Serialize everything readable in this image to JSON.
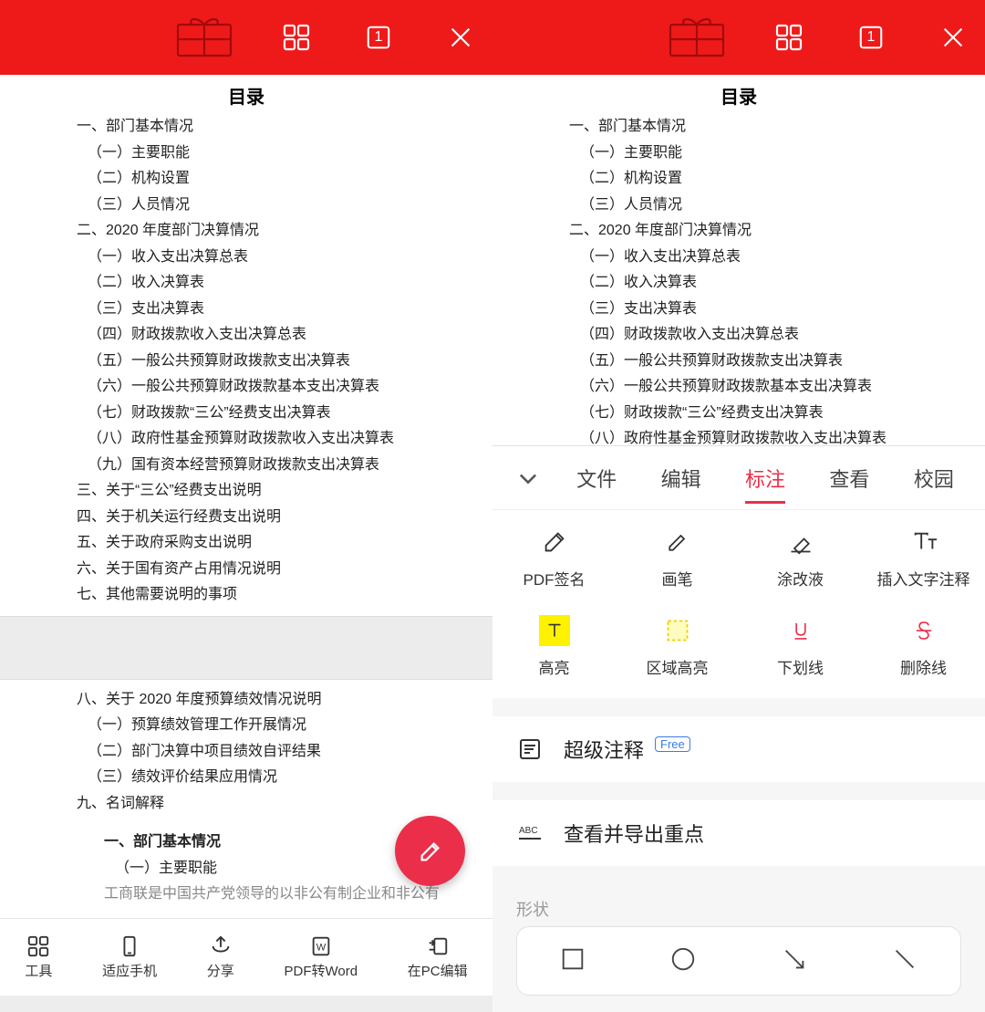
{
  "doc": {
    "title": "目录",
    "lines": [
      {
        "t": "一、部门基本情况",
        "i": 0
      },
      {
        "t": "（一）主要职能",
        "i": 1
      },
      {
        "t": "（二）机构设置",
        "i": 1
      },
      {
        "t": "（三）人员情况",
        "i": 1
      },
      {
        "t": "二、2020 年度部门决算情况",
        "i": 0
      },
      {
        "t": "（一）收入支出决算总表",
        "i": 1
      },
      {
        "t": "（二）收入决算表",
        "i": 1
      },
      {
        "t": "（三）支出决算表",
        "i": 1
      },
      {
        "t": "（四）财政拨款收入支出决算总表",
        "i": 1
      },
      {
        "t": "（五）一般公共预算财政拨款支出决算表",
        "i": 1
      },
      {
        "t": "（六）一般公共预算财政拨款基本支出决算表",
        "i": 1
      },
      {
        "t": "（七）财政拨款“三公”经费支出决算表",
        "i": 1
      },
      {
        "t": "（八）政府性基金预算财政拨款收入支出决算表",
        "i": 1
      },
      {
        "t": "（九）国有资本经营预算财政拨款支出决算表",
        "i": 1
      },
      {
        "t": "三、关于“三公”经费支出说明",
        "i": 0
      },
      {
        "t": "四、关于机关运行经费支出说明",
        "i": 0
      },
      {
        "t": "五、关于政府采购支出说明",
        "i": 0
      },
      {
        "t": "六、关于国有资产占用情况说明",
        "i": 0
      },
      {
        "t": "七、其他需要说明的事项",
        "i": 0
      }
    ],
    "page2": [
      {
        "t": "八、关于 2020 年度预算绩效情况说明",
        "i": 0
      },
      {
        "t": "（一）预算绩效管理工作开展情况",
        "i": 1
      },
      {
        "t": "（二）部门决算中项目绩效自评结果",
        "i": 1
      },
      {
        "t": "（三）绩效评价结果应用情况",
        "i": 1
      },
      {
        "t": "九、名词解释",
        "i": 0
      }
    ],
    "section_head": "一、部门基本情况",
    "section_sub": "（一）主要职能",
    "section_text": "工商联是中国共产党领导的以非公有制企业和非公有"
  },
  "topbar": {
    "page_indicator": "1"
  },
  "bottombar": {
    "tools": "工具",
    "fit": "适应手机",
    "share": "分享",
    "toword": "PDF转Word",
    "pcedit": "在PC编辑"
  },
  "panel": {
    "tabs": {
      "file": "文件",
      "edit": "编辑",
      "annotate": "标注",
      "view": "查看",
      "campus": "校园"
    },
    "tools": {
      "sign": "PDF签名",
      "pen": "画笔",
      "whiteout": "涂改液",
      "textnote": "插入文字注释",
      "highlight": "高亮",
      "areahl": "区域高亮",
      "underline": "下划线",
      "strike": "删除线"
    },
    "super_annot": "超级注释",
    "free_badge": "Free",
    "export_hl": "查看并导出重点",
    "shapes_label": "形状"
  }
}
